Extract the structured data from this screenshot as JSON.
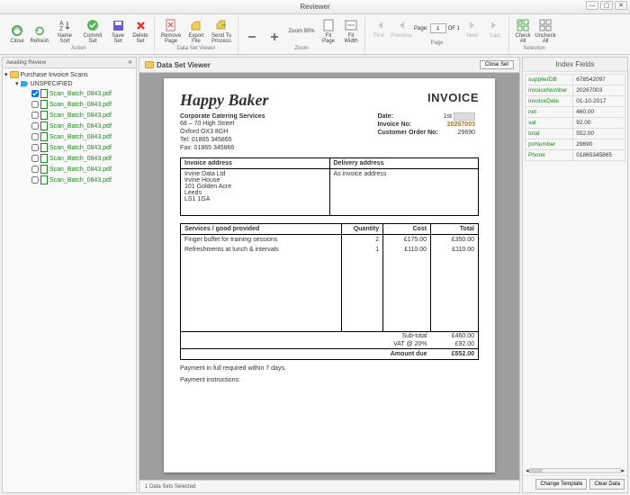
{
  "app_title": "Reviewer",
  "ribbon": {
    "action": {
      "title": "Action",
      "close": "Close",
      "refresh": "Refresh",
      "name_sort": "Name Sort",
      "commit_set": "Commit Set",
      "save_set": "Save Set",
      "delete_set": "Delete Set"
    },
    "data_set_viewer": {
      "title": "Data Set Viewer",
      "remove_page": "Remove Page",
      "export_file": "Export File",
      "send_to_process": "Send To Process"
    },
    "zoom": {
      "title": "Zoom",
      "in": "-",
      "out": "+",
      "label": "Zoom 90%",
      "fit_page": "Fit Page",
      "fit_width": "Fit Width"
    },
    "page": {
      "title": "Page",
      "first": "First",
      "previous": "Previous",
      "page_label": "Page:",
      "page_value": "1",
      "of": "OF 1",
      "next": "Next",
      "last": "Last"
    },
    "selection": {
      "title": "Selection",
      "check_all": "Check All",
      "uncheck_all": "Uncheck All"
    }
  },
  "left": {
    "tab": "Awaiting Review",
    "root": "Purchase Invoice Scans",
    "group": "UNSPECIFIED",
    "files": [
      "Scan_Batch_0843.pdf",
      "Scan_Batch_0843.pdf",
      "Scan_Batch_0843.pdf",
      "Scan_Batch_0843.pdf",
      "Scan_Batch_0843.pdf",
      "Scan_Batch_0843.pdf",
      "Scan_Batch_0843.pdf",
      "Scan_Batch_0843.pdf",
      "Scan_Batch_0843.pdf"
    ]
  },
  "viewer": {
    "title": "Data Set Viewer",
    "close": "Close Set",
    "status": "1 Data Sets Selected"
  },
  "doc": {
    "company": "Happy Baker",
    "subtitle": "Corporate Catering Services",
    "addr1": "68 – 70 High Street",
    "addr2": "Oxford OX3 8GH",
    "tel": "Tel: 01865 345865",
    "fax": "Fax: 01865 345866",
    "invoice_title": "INVOICE",
    "fields": {
      "date_lbl": "Date:",
      "date_val": "1st",
      "inv_no_lbl": "Invoice No:",
      "inv_no_val": "20267003",
      "cust_lbl": "Customer Order No:",
      "cust_val": "29690"
    },
    "addr_head": {
      "left": "Invoice address",
      "right": "Delivery address"
    },
    "inv_addr": "Irvine Data Ltd\nIrvine House\n101 Golden Acre\nLeeds\nLS1 1GA",
    "del_addr": "As invoice address",
    "lines_head": {
      "desc": "Services / good provided",
      "qty": "Quantity",
      "cost": "Cost",
      "total": "Total"
    },
    "lines": [
      {
        "desc": "Finger buffet for training sessions",
        "qty": "2",
        "cost": "£175.00",
        "total": "£350.00"
      },
      {
        "desc": "Refreshments at lunch & intervals",
        "qty": "1",
        "cost": "£110.00",
        "total": "£110.00"
      }
    ],
    "subtotal_lbl": "Sub-total",
    "subtotal": "£460.00",
    "vat_lbl": "VAT @ 20%",
    "vat": "£92.00",
    "amountdue_lbl": "Amount due",
    "amountdue": "£552.00",
    "terms": "Payment in full required within 7 days.",
    "instructions_lbl": "Payment instructions:"
  },
  "index": {
    "title": "Index Fields",
    "rows": [
      {
        "k": "supplierDB",
        "v": "678542097"
      },
      {
        "k": "invoiceNumber",
        "v": "20267003"
      },
      {
        "k": "invoiceDate",
        "v": "01-10-2017"
      },
      {
        "k": "net",
        "v": "460.00"
      },
      {
        "k": "vat",
        "v": "92.00"
      },
      {
        "k": "total",
        "v": "552.00"
      },
      {
        "k": "poNumber",
        "v": "29690"
      },
      {
        "k": "Phone",
        "v": "01865345865"
      }
    ],
    "change_template": "Change Template",
    "clear_data": "Clear Data"
  }
}
